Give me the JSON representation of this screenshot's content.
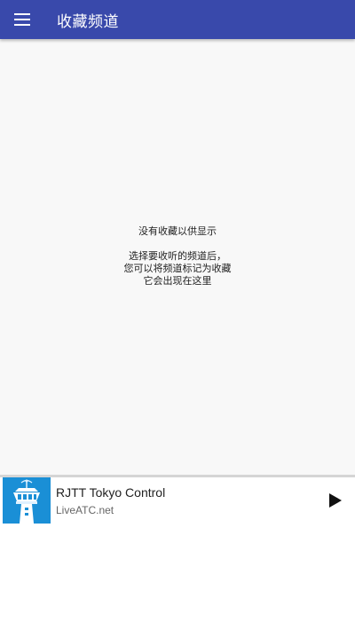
{
  "toolbar": {
    "title": "收藏频道",
    "menu_icon": "hamburger-menu-icon",
    "color": "#3949ab"
  },
  "empty_state": {
    "title": "没有收藏以供显示",
    "lines": [
      "选择要收听的频道后，",
      "您可以将频道标记为收藏",
      "它会出现在这里"
    ]
  },
  "player": {
    "title": "RJTT Tokyo Control",
    "subtitle": "LiveATC.net",
    "thumbnail_icon": "control-tower-icon",
    "thumbnail_color": "#1a8fd6",
    "play_icon": "play-icon"
  }
}
